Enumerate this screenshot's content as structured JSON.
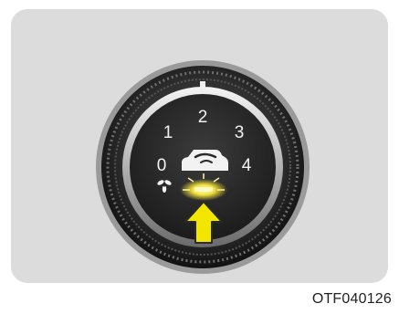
{
  "dial": {
    "speeds": [
      "0",
      "1",
      "2",
      "3",
      "4"
    ],
    "mode_icon": "car-recirculation-icon",
    "fan_icon": "fan-icon",
    "indicator": "indicator-light-icon",
    "pointer": "arrow-up-icon",
    "colors": {
      "panel": "#dcdcdc",
      "dial_face": "#2a2a2a",
      "label": "#f2f2f2",
      "indicator": "#f5e43a",
      "arrow": "#f2e500"
    }
  },
  "figure_code": "OTF040126"
}
